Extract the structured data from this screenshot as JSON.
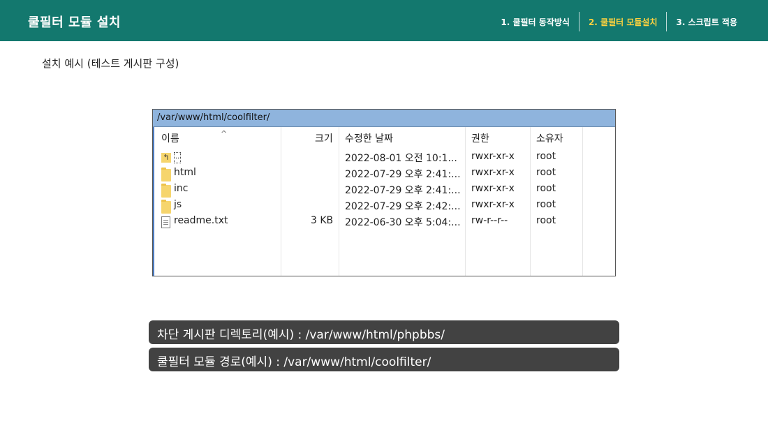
{
  "header": {
    "title": "쿨필터 모듈 설치",
    "steps": [
      {
        "label": "1. 쿨필터 동작방식"
      },
      {
        "label": "2. 쿨필터 모듈설치"
      },
      {
        "label": "3. 스크립트 적용"
      }
    ],
    "active_step_color": "#ffd23f",
    "background_color": "#13786e"
  },
  "subtitle": "설치 예시 (테스트 게시판 구성)",
  "explorer": {
    "path": "/var/www/html/coolfilter/",
    "columns": {
      "name": "이름",
      "size": "크기",
      "modified": "수정한 날짜",
      "permission": "권한",
      "owner": "소유자"
    },
    "rows": [
      {
        "icon": "up-folder-icon",
        "name": "..",
        "size": "",
        "modified": "2022-08-01 오전 10:1...",
        "permission": "rwxr-xr-x",
        "owner": "root"
      },
      {
        "icon": "folder-icon",
        "name": "html",
        "size": "",
        "modified": "2022-07-29 오후 2:41:...",
        "permission": "rwxr-xr-x",
        "owner": "root"
      },
      {
        "icon": "folder-icon",
        "name": "inc",
        "size": "",
        "modified": "2022-07-29 오후 2:41:...",
        "permission": "rwxr-xr-x",
        "owner": "root"
      },
      {
        "icon": "folder-icon",
        "name": "js",
        "size": "",
        "modified": "2022-07-29 오후 2:42:...",
        "permission": "rwxr-xr-x",
        "owner": "root"
      },
      {
        "icon": "text-file-icon",
        "name": "readme.txt",
        "size": "3 KB",
        "modified": "2022-06-30 오후 5:04:...",
        "permission": "rw-r--r--",
        "owner": "root"
      }
    ]
  },
  "info": {
    "blocked_board_path": "차단 게시판 디렉토리(예시) : /var/www/html/phpbbs/",
    "module_path": "쿨필터 모듈 경로(예시) : /var/www/html/coolfilter/"
  }
}
